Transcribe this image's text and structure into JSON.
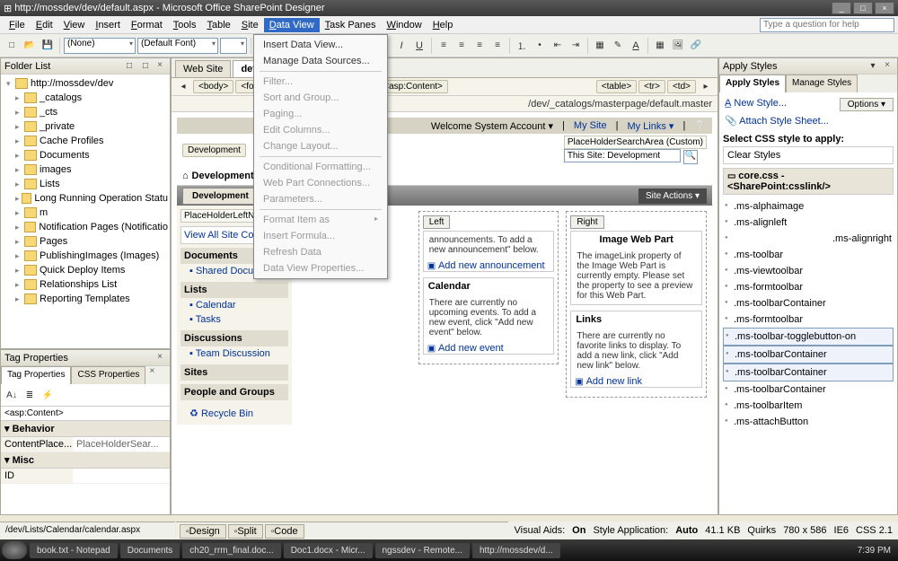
{
  "titlebar": {
    "title": "http://mossdev/dev/default.aspx - Microsoft Office SharePoint Designer",
    "min": "_",
    "max": "□",
    "close": "×"
  },
  "menu": {
    "items": [
      "File",
      "Edit",
      "View",
      "Insert",
      "Format",
      "Tools",
      "Table",
      "Site",
      "Data View",
      "Task Panes",
      "Window",
      "Help"
    ],
    "active_index": 8,
    "help_placeholder": "Type a question for help"
  },
  "toolbar": {
    "style_sel": "(None)",
    "font_sel": "(Default Font)"
  },
  "dropdown": {
    "items": [
      {
        "label": "Insert Data View...",
        "enabled": true
      },
      {
        "label": "Manage Data Sources...",
        "enabled": true
      },
      {
        "sep": true
      },
      {
        "label": "Filter...",
        "enabled": false
      },
      {
        "label": "Sort and Group...",
        "enabled": false
      },
      {
        "label": "Paging...",
        "enabled": false
      },
      {
        "label": "Edit Columns...",
        "enabled": false
      },
      {
        "label": "Change Layout...",
        "enabled": false
      },
      {
        "sep": true
      },
      {
        "label": "Conditional Formatting...",
        "enabled": false
      },
      {
        "label": "Web Part Connections...",
        "enabled": false
      },
      {
        "label": "Parameters...",
        "enabled": false
      },
      {
        "sep": true
      },
      {
        "label": "Format Item as",
        "enabled": false,
        "submenu": true
      },
      {
        "label": "Insert Formula...",
        "enabled": false
      },
      {
        "label": "Refresh Data",
        "enabled": false
      },
      {
        "label": "Data View Properties...",
        "enabled": false
      }
    ]
  },
  "folderlist": {
    "title": "Folder List",
    "root": "http://mossdev/dev",
    "nodes": [
      "_catalogs",
      "_cts",
      "_private",
      "Cache Profiles",
      "Documents",
      "images",
      "Lists",
      "Long Running Operation Statu",
      "m",
      "Notification Pages (Notificatio",
      "Pages",
      "PublishingImages (Images)",
      "Quick Deploy Items",
      "Relationships List",
      "Reporting Templates"
    ]
  },
  "tagprops": {
    "title": "Tag Properties",
    "tabs": [
      "Tag Properties",
      "CSS Properties"
    ],
    "selector": "<asp:Content>",
    "cats": [
      {
        "name": "Behavior",
        "rows": [
          {
            "k": "ContentPlace...",
            "v": "PlaceHolderSear..."
          }
        ]
      },
      {
        "name": "Misc",
        "rows": [
          {
            "k": "ID",
            "v": ""
          }
        ]
      }
    ]
  },
  "doctabs": {
    "tabs": [
      {
        "label": "Web Site",
        "active": false
      },
      {
        "label": "default",
        "active": true
      }
    ]
  },
  "crumbs": [
    "<body>",
    "<form>",
    "<table>",
    "<tr>",
    "<td>",
    "<asp:Content>"
  ],
  "crumbs2_prefix": [
    "<table>",
    "<tr>",
    "<td>"
  ],
  "masterpath": "/dev/_catalogs/masterpage/default.master",
  "sp": {
    "welcome": "Welcome System Account ▾",
    "mysite": "My Site",
    "mylinks": "My Links ▾",
    "search_ph_label": "PlaceHolderSearchArea (Custom)",
    "search_scope": "This Site: Development",
    "breadcrumb": "Development",
    "title": "Development",
    "title_icon": "⌂",
    "tab": "Development",
    "siteactions": "Site Actions ▾",
    "leftnav_ph": "PlaceHolderLeftNavBarD",
    "viewall": "View All Site Content",
    "ql": [
      {
        "head": "Documents",
        "items": [
          "Shared Documents"
        ]
      },
      {
        "head": "Lists",
        "items": [
          "Calendar",
          "Tasks"
        ]
      },
      {
        "head": "Discussions",
        "items": [
          "Team Discussion"
        ]
      },
      {
        "head": "Sites",
        "items": []
      },
      {
        "head": "People and Groups",
        "items": []
      }
    ],
    "recycle": "Recycle Bin",
    "left_label": "Left",
    "right_label": "Right",
    "ann_title": "",
    "ann_body": "announcements. To add a new announcement\" below.",
    "ann_add": "Add new announcement",
    "cal_title": "Calendar",
    "cal_body": "There are currently no upcoming events. To add a new event, click \"Add new event\" below.",
    "cal_add": "Add new event",
    "img_title": "Image Web Part",
    "img_body": "The imageLink property of the Image Web Part is currently empty. Please set the property to see a preview for this Web Part.",
    "links_title": "Links",
    "links_body": "There are currently no favorite links to display. To add a new link, click \"Add new link\" below.",
    "links_add": "Add new link"
  },
  "views": {
    "design": "Design",
    "split": "Split",
    "code": "Code"
  },
  "applystyles": {
    "title": "Apply Styles",
    "tabs": [
      "Apply Styles",
      "Manage Styles"
    ],
    "newstyle": "New Style...",
    "options": "Options ▾",
    "attach": "Attach Style Sheet...",
    "selectlabel": "Select CSS style to apply:",
    "clear": "Clear Styles",
    "source": "core.css - <SharePoint:csslink/>",
    "classes": [
      ".ms-alphaimage",
      ".ms-alignleft",
      ".ms-alignright",
      ".ms-toolbar",
      ".ms-viewtoolbar",
      ".ms-formtoolbar",
      ".ms-toolbarContainer",
      ".ms-formtoolbar",
      ".ms-toolbar-togglebutton-on",
      ".ms-toolbarContainer",
      ".ms-toolbarContainer",
      ".ms-toolbarContainer",
      ".ms-toolbarItem",
      ".ms-attachButton"
    ],
    "boxed_indices": [
      8,
      9,
      10
    ]
  },
  "status": {
    "path": "/dev/Lists/Calendar/calendar.aspx",
    "visual": "Visual Aids:",
    "visual_v": "On",
    "styleapp": "Style Application:",
    "styleapp_v": "Auto",
    "size": "41.1 KB",
    "quirks": "Quirks",
    "dims": "780 x 586",
    "ie": "IE6",
    "css": "CSS 2.1"
  },
  "taskbar": {
    "items": [
      "book.txt - Notepad",
      "Documents",
      "ch20_rrm_final.doc...",
      "Doc1.docx - Micr...",
      "ngssdev - Remote...",
      "http://mossdev/d..."
    ],
    "clock": "7:39 PM"
  }
}
